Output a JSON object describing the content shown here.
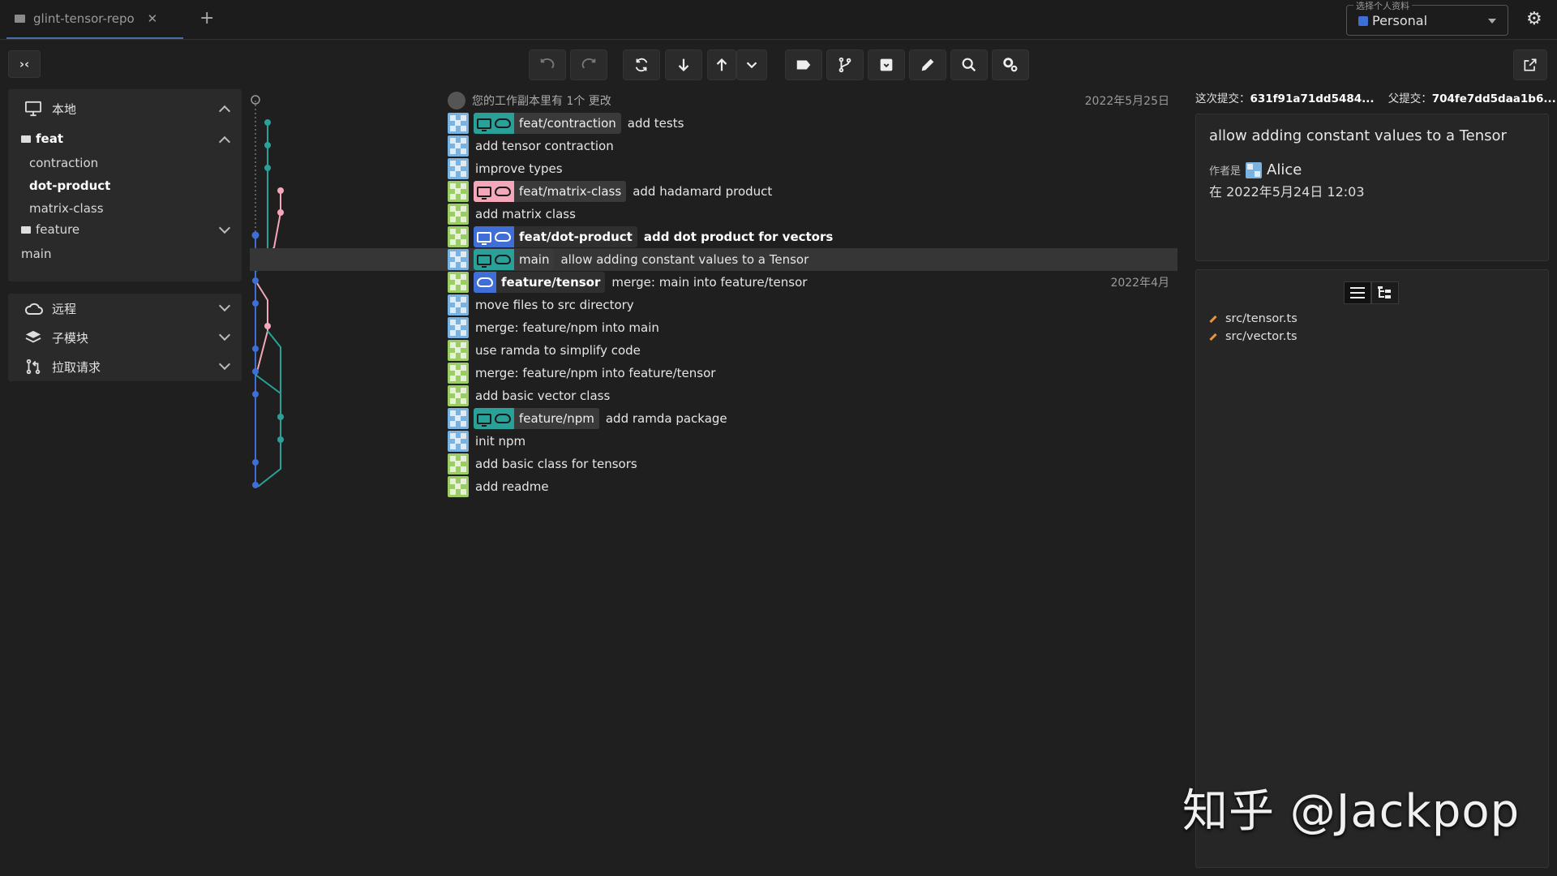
{
  "tab": {
    "title": "glint-tensor-repo"
  },
  "profile": {
    "legend": "选择个人资料",
    "value": "Personal"
  },
  "sidebar": {
    "local": {
      "label": "本地"
    },
    "groups": [
      {
        "label": "feat",
        "items": [
          "contraction",
          "dot-product",
          "matrix-class"
        ],
        "active": "dot-product"
      },
      {
        "label": "feature",
        "items": []
      }
    ],
    "main": "main",
    "remote": "远程",
    "submodules": "子模块",
    "pull_requests": "拉取请求"
  },
  "working_copy": "您的工作副本里有 1个 更改",
  "commits": [
    {
      "avatar": "blue",
      "branch": "feat/contraction",
      "badge": "teal",
      "icons": [
        "local",
        "remote"
      ],
      "message": "add tests"
    },
    {
      "avatar": "blue",
      "message": "add tensor contraction"
    },
    {
      "avatar": "blue",
      "message": "improve types"
    },
    {
      "avatar": "green",
      "branch": "feat/matrix-class",
      "badge": "pink",
      "icons": [
        "local",
        "remote"
      ],
      "message": "add hadamard product"
    },
    {
      "avatar": "green",
      "message": "add matrix class"
    },
    {
      "avatar": "green",
      "branch": "feat/dot-product",
      "badge": "blue",
      "icons": [
        "local",
        "remote"
      ],
      "message": "add dot product for vectors",
      "bold": true
    },
    {
      "avatar": "blue",
      "branch": "main",
      "badge": "teal",
      "icons": [
        "local",
        "remote"
      ],
      "message": "allow adding constant values to a Tensor",
      "selected": true
    },
    {
      "avatar": "green",
      "branch": "feature/tensor",
      "badge": "blue",
      "icons": [
        "remote"
      ],
      "message": "merge: main into feature/tensor"
    },
    {
      "avatar": "blue",
      "message": "move files to src directory"
    },
    {
      "avatar": "blue",
      "message": "merge: feature/npm into main"
    },
    {
      "avatar": "green",
      "message": "use ramda to simplify code"
    },
    {
      "avatar": "green",
      "message": "merge: feature/npm into feature/tensor"
    },
    {
      "avatar": "green",
      "message": "add basic vector class"
    },
    {
      "avatar": "blue",
      "branch": "feature/npm",
      "badge": "teal",
      "icons": [
        "local",
        "remote"
      ],
      "message": "add ramda package"
    },
    {
      "avatar": "blue",
      "message": "init npm"
    },
    {
      "avatar": "green",
      "message": "add basic class for tensors"
    },
    {
      "avatar": "green",
      "message": "add readme"
    }
  ],
  "dates": {
    "top": "2022年5月25日",
    "april": "2022年4月"
  },
  "detail": {
    "this_commit_label": "这次提交：",
    "this_commit": "631f91a71dd5484...",
    "parent_label": "父提交：",
    "parent": "704fe7dd5daa1b6...",
    "subject": "allow adding constant values to a Tensor",
    "author_label": "作者是",
    "author": "Alice",
    "date": "在 2022年5月24日 12:03"
  },
  "files": [
    "src/tensor.ts",
    "src/vector.ts"
  ],
  "watermark": "知乎 @Jackpop"
}
